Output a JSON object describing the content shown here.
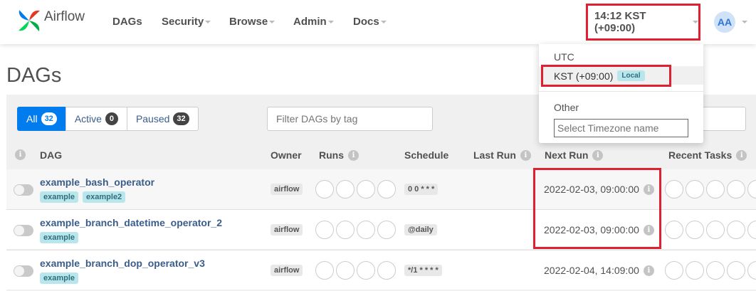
{
  "app": {
    "name": "Airflow"
  },
  "nav": {
    "items": [
      {
        "label": "DAGs",
        "has_caret": false
      },
      {
        "label": "Security",
        "has_caret": true
      },
      {
        "label": "Browse",
        "has_caret": true
      },
      {
        "label": "Admin",
        "has_caret": true
      },
      {
        "label": "Docs",
        "has_caret": true
      }
    ],
    "time": "14:12 KST (+09:00)",
    "avatar": "AA"
  },
  "timezone_menu": {
    "utc": "UTC",
    "local": "KST (+09:00)",
    "local_badge": "Local",
    "other": "Other",
    "input_placeholder": "Select Timezone name"
  },
  "page": {
    "title": "DAGs"
  },
  "filters": {
    "all_label": "All",
    "all_count": "32",
    "active_label": "Active",
    "active_count": "0",
    "paused_label": "Paused",
    "paused_count": "32",
    "tag_placeholder": "Filter DAGs by tag"
  },
  "table": {
    "headers": {
      "dag": "DAG",
      "owner": "Owner",
      "runs": "Runs",
      "schedule": "Schedule",
      "last_run": "Last Run",
      "next_run": "Next Run",
      "recent_tasks": "Recent Tasks"
    },
    "rows": [
      {
        "name": "example_bash_operator",
        "tags": [
          "example",
          "example2"
        ],
        "owner": "airflow",
        "schedule": "0 0 * * *",
        "next_run": "2022-02-03, 09:00:00"
      },
      {
        "name": "example_branch_datetime_operator_2",
        "tags": [
          "example"
        ],
        "owner": "airflow",
        "schedule": "@daily",
        "next_run": "2022-02-03, 09:00:00"
      },
      {
        "name": "example_branch_dop_operator_v3",
        "tags": [
          "example"
        ],
        "owner": "airflow",
        "schedule": "*/1 * * * *",
        "next_run": "2022-02-04, 14:09:00"
      }
    ]
  },
  "colors": {
    "accent": "#017cee",
    "highlight": "#e02030",
    "link": "#3a5d8b"
  }
}
